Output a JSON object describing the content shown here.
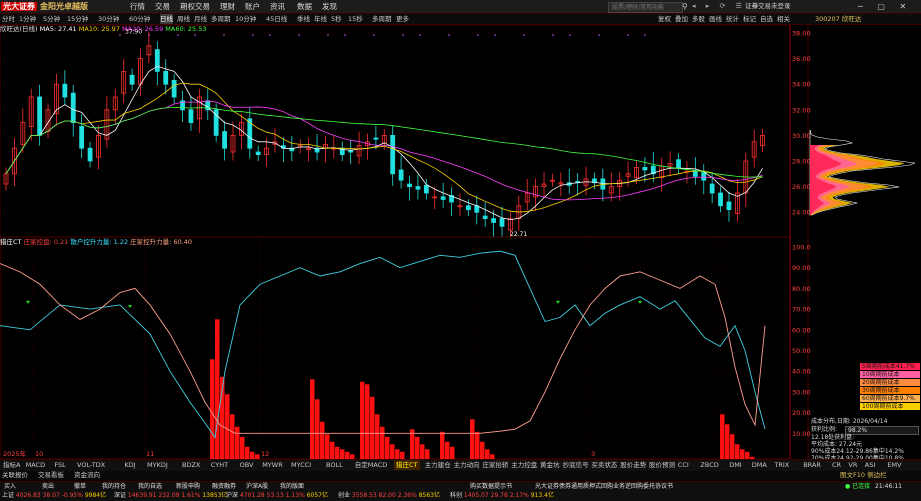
{
  "app": {
    "logo": "光大证券",
    "brand": "金阳光卓越版",
    "menus": [
      "行情",
      "交易",
      "期权交易",
      "理财",
      "账户",
      "资讯",
      "数据",
      "发现"
    ],
    "search_placeholder": "股票/理财/常用功能",
    "login_text": "证券交易未登录"
  },
  "periods": [
    "分时",
    "1分钟",
    "5分钟",
    "15分钟",
    "30分钟",
    "60分钟",
    "日线",
    "周线",
    "月线",
    "多周期",
    "10分钟",
    "45日线",
    "季线",
    "年线",
    "5秒",
    "15秒",
    "多周期",
    "更多"
  ],
  "active_period": "日线",
  "right_tools": [
    "复权",
    "叠加",
    "多股",
    "画线",
    "统计",
    "标记",
    "自选",
    "相关"
  ],
  "stock": {
    "code_name": "300207 欣旺达",
    "title": "欣旺达(日线)"
  },
  "ma_legend": [
    {
      "label": "MA5: 27.41",
      "color": "#ffffff"
    },
    {
      "label": "MA10: 25.97",
      "color": "#ffd000"
    },
    {
      "label": "MA20: 26.59",
      "color": "#ff40ff"
    },
    {
      "label": "MA60: 25.53",
      "color": "#40ff40"
    }
  ],
  "price_axis": [
    "38.00",
    "36.00",
    "34.00",
    "32.00",
    "30.00",
    "28.00",
    "26.00",
    "24.00"
  ],
  "annotations": {
    "high": "37.90",
    "low": "22.71"
  },
  "indicator_legend": [
    {
      "label": "猎庄CT",
      "color": "#ffffff"
    },
    {
      "label": "庄家控盘: 0.21",
      "color": "#ff4040"
    },
    {
      "label": "散户控升力量: 1.22",
      "color": "#40e0ff"
    },
    {
      "label": "庄家控升力量: 60.40",
      "color": "#ffa080"
    }
  ],
  "indicator_axis": [
    "100.0",
    "90.00",
    "80.00",
    "70.00",
    "60.00",
    "50.00",
    "40.00",
    "30.00",
    "20.00",
    "10.00"
  ],
  "time_axis": [
    "2025年",
    "10",
    "11",
    "12",
    "2",
    "3",
    "4"
  ],
  "cost_legend": [
    {
      "label": "5周期前成本41.7%",
      "color": "#ff2050"
    },
    {
      "label": "10周期前成本49.7%",
      "color": "#ff60a0"
    },
    {
      "label": "20周期前成本27.7%",
      "color": "#ff8c40"
    },
    {
      "label": "30周期前成本18.3%",
      "color": "#ff8000"
    },
    {
      "label": "60周期前成本9.7%",
      "color": "#ffb050"
    },
    {
      "label": "100周期前成本1.6%",
      "color": "#ffd000"
    }
  ],
  "cost_info": {
    "title": "成本分布,日期: 2026/04/14",
    "profit_label": "获利比例:",
    "profit_value": "98.2%",
    "lines": [
      "12.18处获利盘:",
      "平均成本: 27.24元",
      "90%成本24.12-29.86集中14.2%",
      "70%成本24.92-29.00集中10.8%"
    ]
  },
  "tabs": [
    "指标A",
    "MACD",
    "FSL",
    "VOL-TDX",
    "KDJ",
    "MYKDJ",
    "BDZX",
    "CYHT",
    "OBV",
    "MYWR",
    "MYCCI",
    "BOLL",
    "自定MACD",
    "猎庄CT",
    "主力建仓",
    "主力动向",
    "庄家抬轿",
    "主力控盘",
    "黄金坑",
    "抄底信号",
    "买卖状态",
    "股价走势",
    "股价预测",
    "CCI",
    "ZBCD",
    "DMI",
    "DMA",
    "TRIX",
    "BRAR",
    "CR",
    "VR",
    "ASI",
    "EMV",
    "RSI",
    "WR",
    "指标B",
    "日线"
  ],
  "active_tab": "猎庄CT",
  "ctrl_items": [
    "关联报价",
    "交易看板",
    "资金流向"
  ],
  "ctrl_right": "图文F10 侧边栏",
  "status": {
    "line1": [
      {
        "text": "买入",
        "cls": "wht"
      },
      {
        "text": "卖出",
        "cls": "wht"
      },
      {
        "text": "撤单",
        "cls": "wht"
      },
      {
        "text": "我的持仓",
        "cls": "wht"
      },
      {
        "text": "我的自选",
        "cls": "wht"
      },
      {
        "text": "新股申购",
        "cls": "wht"
      },
      {
        "text": "融资融券",
        "cls": "wht"
      },
      {
        "text": "沪深A股",
        "cls": "wht"
      },
      {
        "text": "我的版面",
        "cls": "wht"
      },
      {
        "text": "购买数据提示书",
        "cls": "wht"
      },
      {
        "text": "光大证券债券通用质押式回购业务逆回购委托协议书",
        "cls": "wht"
      }
    ],
    "indices": [
      {
        "name": "上证",
        "val": "4026.83",
        "chg": "38.07",
        "pct": "-0.95%",
        "amt": "9984亿",
        "dir": "up"
      },
      {
        "name": "深证",
        "val": "14639.91",
        "chg": "232.09",
        "pct": "1.61%",
        "amt": "13853亿",
        "dir": "up"
      },
      {
        "name": "沪深",
        "val": "4701.28",
        "chg": "53.13",
        "pct": "1.13%",
        "amt": "6057亿",
        "dir": "up"
      },
      {
        "name": "创业",
        "val": "3558.53",
        "chg": "82.00",
        "pct": "2.36%",
        "amt": "8563亿",
        "dir": "up"
      },
      {
        "name": "科创",
        "val": "1405.07",
        "chg": "29.78",
        "pct": "2.17%",
        "amt": "913.4亿",
        "dir": "up"
      }
    ],
    "connected": "已连接",
    "time": "21:46:11"
  }
}
